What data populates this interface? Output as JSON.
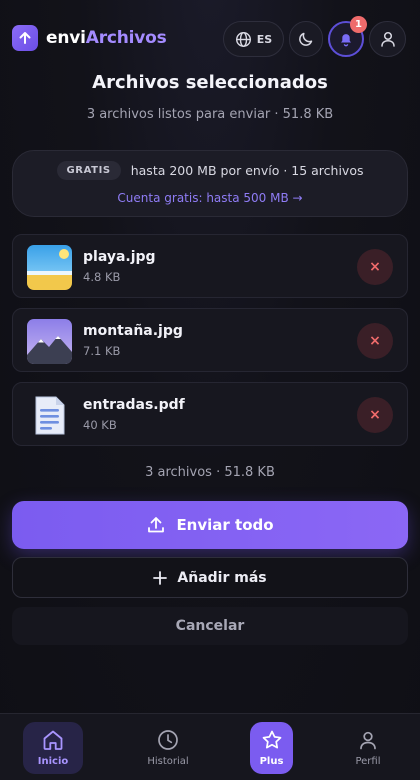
{
  "app": {
    "name_part1": "envi",
    "name_part2": "Archivos"
  },
  "header": {
    "language": "ES",
    "notification_count": "1"
  },
  "page": {
    "title": "Archivos seleccionados",
    "subtitle": "3 archivos listos para enviar · 51.8 KB"
  },
  "plan": {
    "badge": "GRATIS",
    "limits": "hasta 200 MB por envío · 15 archivos",
    "upgrade_link": "Cuenta gratis: hasta 500 MB →"
  },
  "files": [
    {
      "name": "playa.jpg",
      "size": "4.8 KB",
      "remove_label": "×"
    },
    {
      "name": "montaña.jpg",
      "size": "7.1 KB",
      "remove_label": "×"
    },
    {
      "name": "entradas.pdf",
      "size": "40 KB",
      "remove_label": "×"
    }
  ],
  "summary": {
    "total": "3 archivos · 51.8 KB"
  },
  "actions": {
    "send_all": "Enviar todo",
    "add_more": "Añadir más",
    "cancel": "Cancelar"
  },
  "nav": [
    {
      "label": "Inicio",
      "icon": "home-icon",
      "active": true
    },
    {
      "label": "Historial",
      "icon": "clock-icon",
      "active": false
    },
    {
      "label": "Plus",
      "icon": "star-icon",
      "active": false
    },
    {
      "label": "Perfil",
      "icon": "user-icon",
      "active": false
    }
  ],
  "colors": {
    "accent": "#7b5cf0",
    "danger": "#ef6b6b",
    "background": "#121219"
  }
}
